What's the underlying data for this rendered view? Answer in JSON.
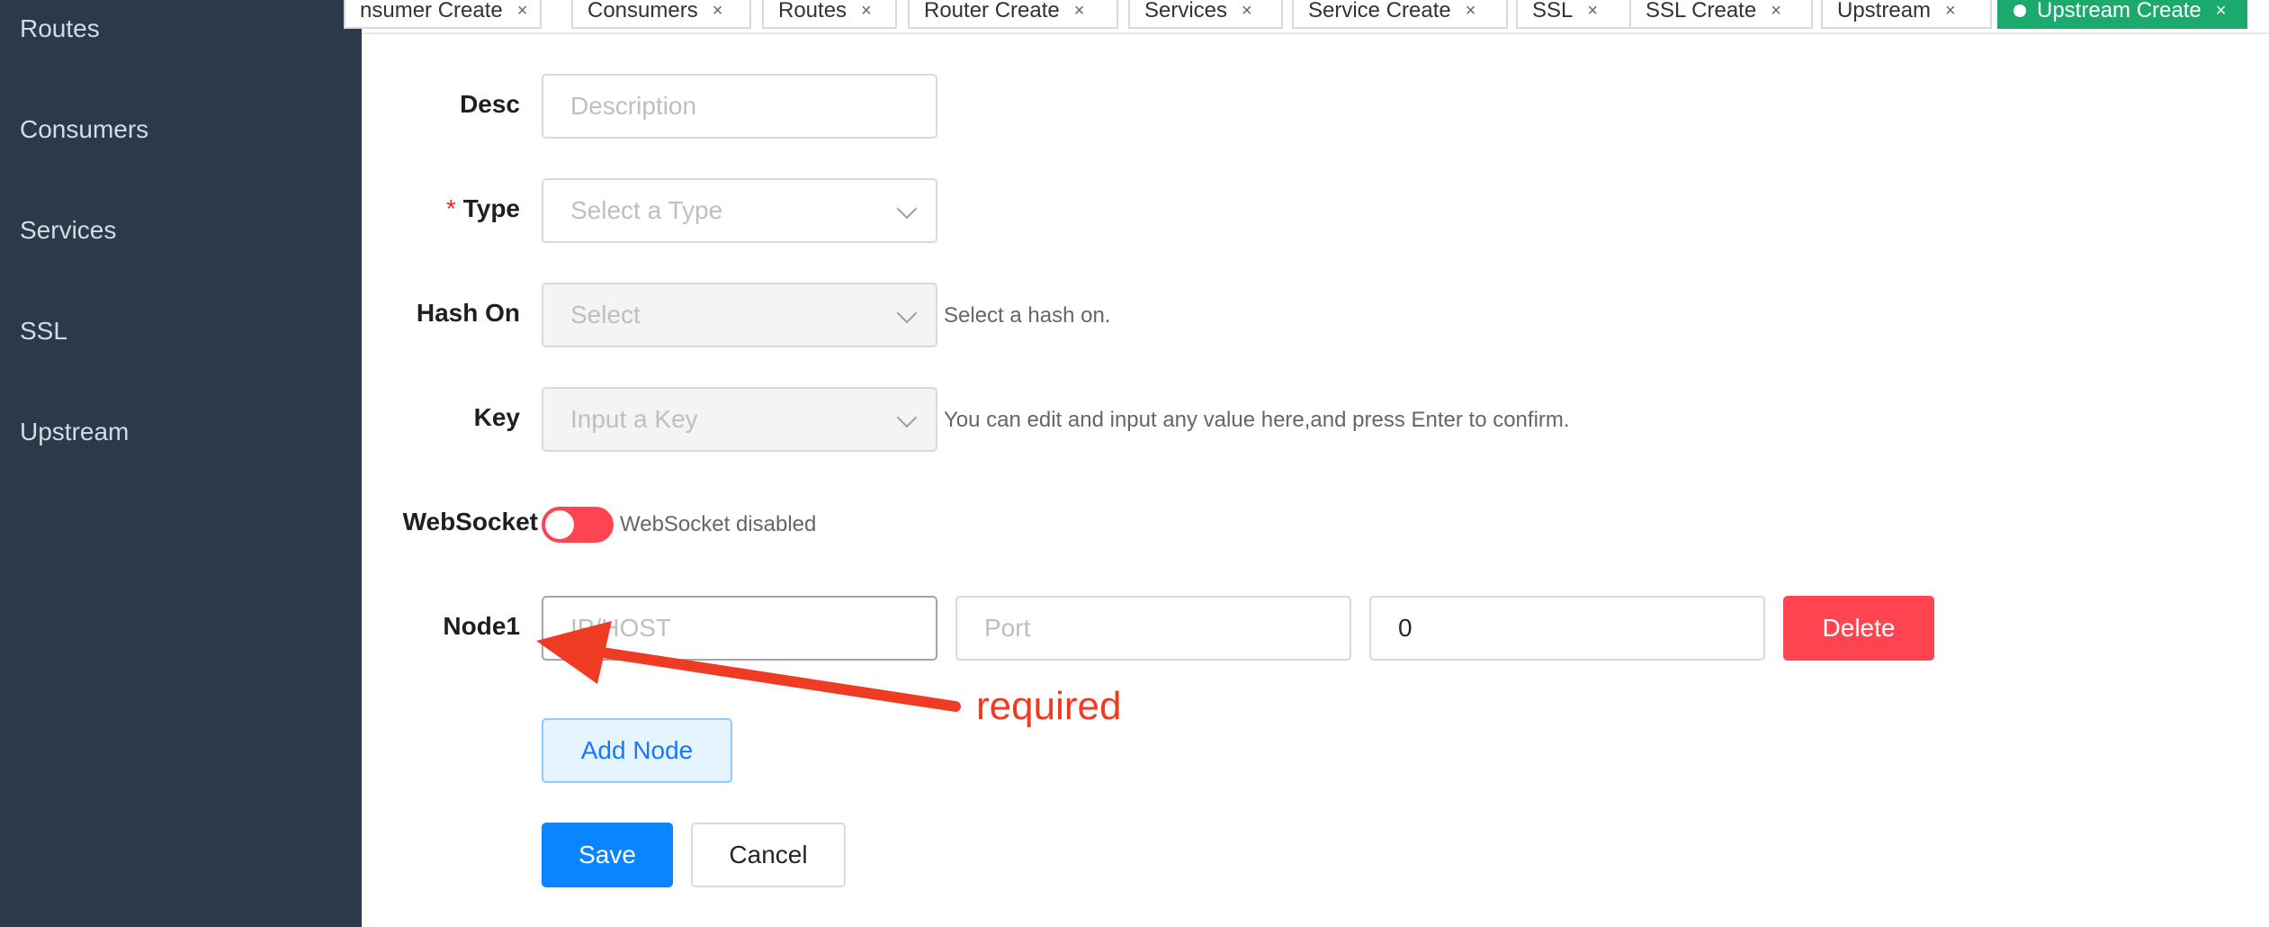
{
  "sidebar": {
    "items": [
      {
        "label": "Routes"
      },
      {
        "label": "Consumers"
      },
      {
        "label": "Services"
      },
      {
        "label": "SSL"
      },
      {
        "label": "Upstream"
      }
    ]
  },
  "tabs": [
    {
      "label": "nsumer Create",
      "close": "×"
    },
    {
      "label": "Consumers",
      "close": "×"
    },
    {
      "label": "Routes",
      "close": "×"
    },
    {
      "label": "Router Create",
      "close": "×"
    },
    {
      "label": "Services",
      "close": "×"
    },
    {
      "label": "Service Create",
      "close": "×"
    },
    {
      "label": "SSL",
      "close": "×"
    },
    {
      "label": "SSL Create",
      "close": "×"
    },
    {
      "label": "Upstream",
      "close": "×"
    },
    {
      "label": "Upstream Create",
      "close": "×",
      "active": true
    }
  ],
  "form": {
    "desc": {
      "label": "Desc",
      "placeholder": "Description"
    },
    "type": {
      "required_mark": "*",
      "label": "Type",
      "placeholder": "Select a Type"
    },
    "hash_on": {
      "label": "Hash On",
      "placeholder": "Select",
      "help": "Select a hash on."
    },
    "key": {
      "label": "Key",
      "placeholder": "Input a Key",
      "help": "You can edit and input any value here,and press Enter to confirm."
    },
    "websocket": {
      "label": "WebSocket",
      "status": "WebSocket disabled",
      "enabled": false
    },
    "node": {
      "label": "Node1",
      "host_placeholder": "IP/HOST",
      "port_placeholder": "Port",
      "weight_value": "0",
      "delete_label": "Delete"
    },
    "add_node_label": "Add Node",
    "save_label": "Save",
    "cancel_label": "Cancel"
  },
  "annotation": {
    "text": "required",
    "color": "#ef3a24"
  },
  "colors": {
    "sidebar_bg": "#2b3a4a",
    "active_tab": "#1aaa6d",
    "danger": "#ff4451",
    "primary": "#0a84ff"
  }
}
